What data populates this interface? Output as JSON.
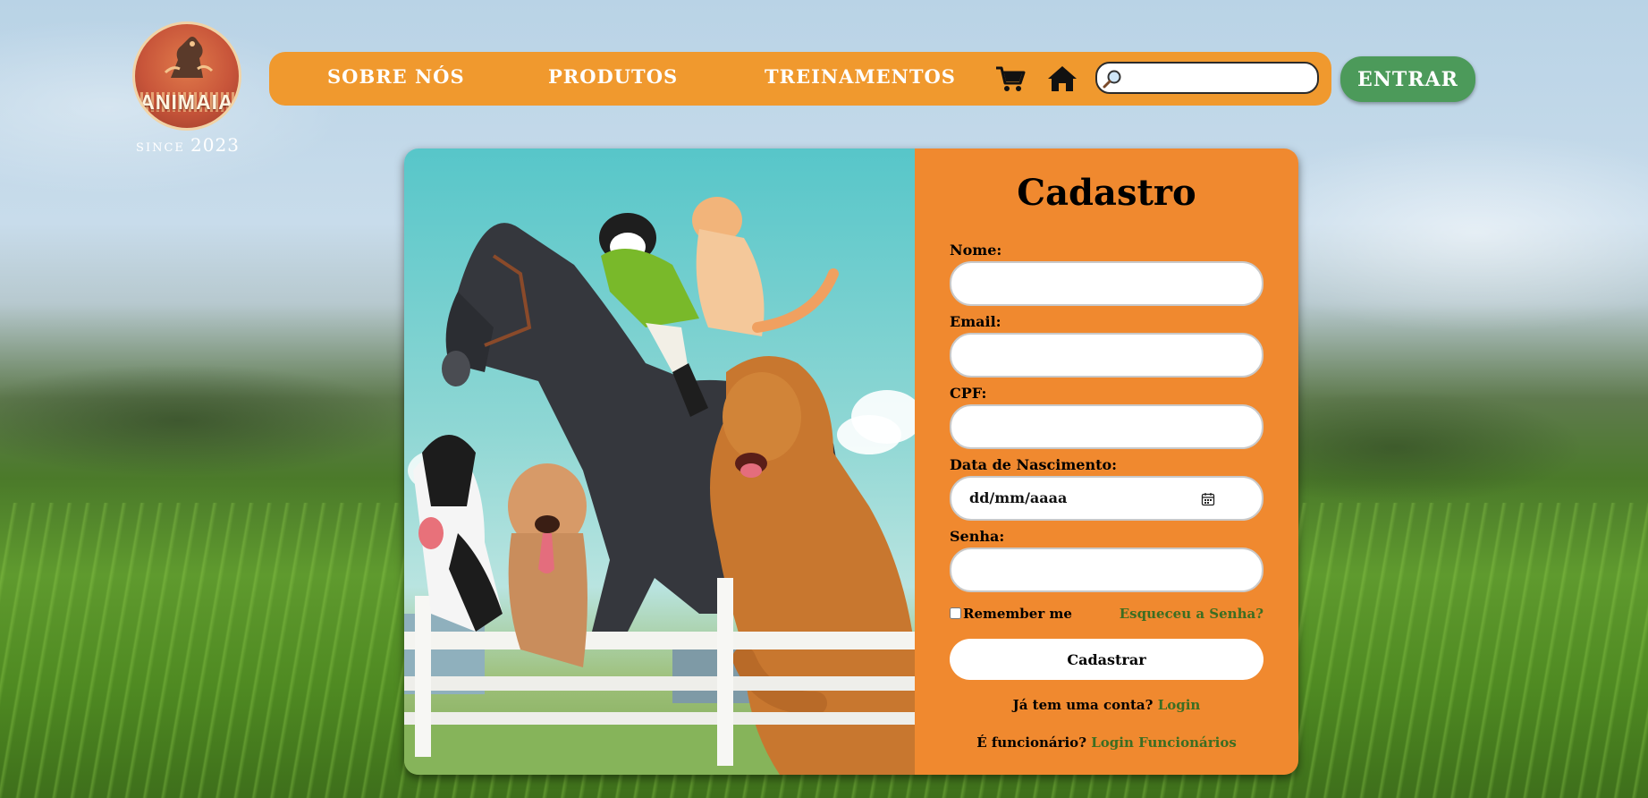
{
  "logo": {
    "name": "ANIMAIA",
    "since_label": "SINCE",
    "since_year": "2023",
    "icon": "horse-logo-icon"
  },
  "nav": {
    "items": [
      {
        "label": "SOBRE NÓS"
      },
      {
        "label": "PRODUTOS"
      },
      {
        "label": "TREINAMENTOS"
      }
    ],
    "cart_icon": "cart-icon",
    "home_icon": "home-icon",
    "search": {
      "placeholder": "",
      "value": "",
      "icon": "search-icon"
    },
    "login_button": "ENTRAR"
  },
  "form": {
    "title": "Cadastro",
    "fields": [
      {
        "label": "Nome:",
        "value": ""
      },
      {
        "label": "Email:",
        "value": ""
      },
      {
        "label": "CPF:",
        "value": ""
      },
      {
        "label": "Data de Nascimento:",
        "placeholder": "dd/mm/aaaa"
      },
      {
        "label": "Senha:",
        "value": ""
      }
    ],
    "remember_me": "Remember me",
    "forgot_password": "Esqueceu a Senha?",
    "submit": "Cadastrar",
    "have_account": "Já tem uma conta?",
    "login_link": "Login",
    "employee_question": "É funcionário?",
    "employee_login": "Login Funcionários"
  },
  "colors": {
    "nav_orange": "#f0992e",
    "form_orange": "#f0892f",
    "login_green": "#4c9a5a",
    "link_green": "#3c6e22"
  }
}
